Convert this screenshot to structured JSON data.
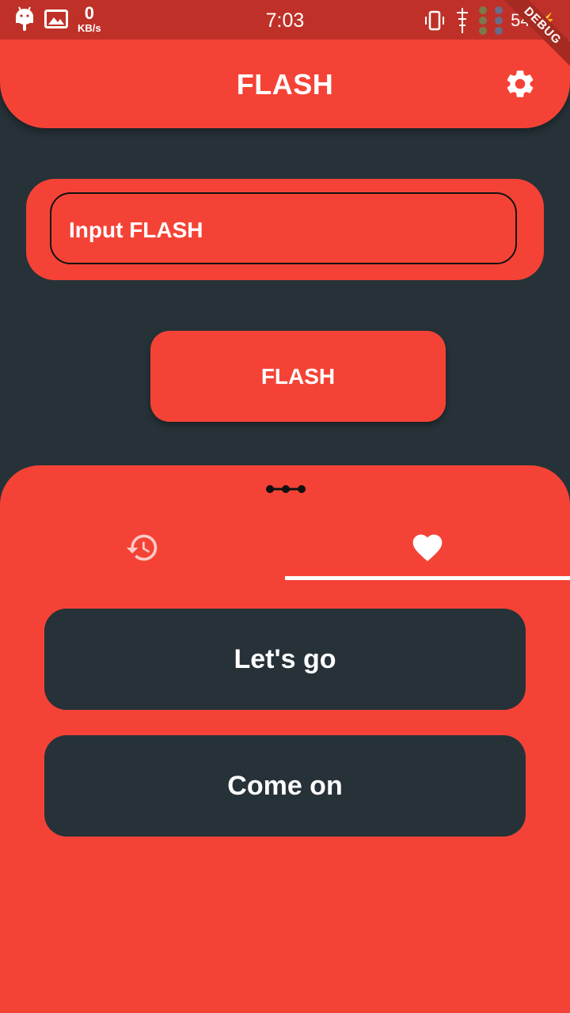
{
  "status_bar": {
    "speed_value": "0",
    "speed_unit": "KB/s",
    "time": "7:03",
    "battery": "54"
  },
  "debug_banner": "DEBUG",
  "app_bar": {
    "title": "FLASH"
  },
  "input": {
    "placeholder": "Input FLASH"
  },
  "flash_button": {
    "label": "FLASH"
  },
  "tabs": [
    {
      "icon": "history-icon",
      "selected": false
    },
    {
      "icon": "heart-icon",
      "selected": true
    }
  ],
  "favorites": [
    {
      "label": "Let's go"
    },
    {
      "label": "Come on"
    }
  ],
  "colors": {
    "primary": "#f44336",
    "background": "#263238",
    "status_bar": "#bf3128"
  }
}
